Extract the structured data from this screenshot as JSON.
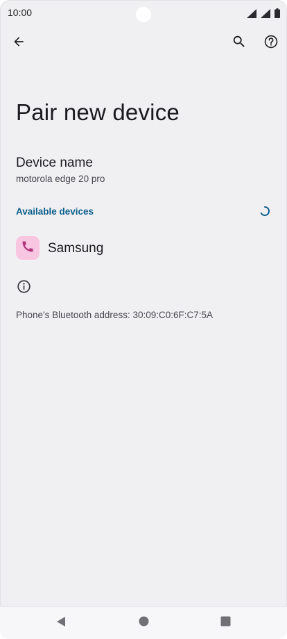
{
  "status_bar": {
    "time": "10:00",
    "icons": [
      "wifi-signal-icon",
      "cell-signal-icon",
      "battery-icon"
    ]
  },
  "app_bar": {
    "icons": [
      "back-arrow-icon",
      "search-icon",
      "help-icon"
    ]
  },
  "page": {
    "title": "Pair new device"
  },
  "device_name": {
    "title": "Device name",
    "value": "motorola edge 20 pro"
  },
  "available_devices": {
    "header": "Available devices",
    "items": [
      {
        "label": "Samsung",
        "icon": "phone-icon",
        "icon_bg": "#f9c6e2",
        "icon_color": "#b0357a"
      }
    ]
  },
  "info": {
    "icon": "info-icon",
    "bluetooth_address": "Phone's Bluetooth address: 30:09:C0:6F:C7:5A"
  },
  "nav_bar": {
    "icons": [
      "nav-back-icon",
      "nav-home-icon",
      "nav-recents-icon"
    ]
  },
  "colors": {
    "background": "#f0f0f3",
    "accent": "#0b5e8a",
    "text_primary": "#1b1b1f",
    "text_secondary": "#46464f"
  }
}
